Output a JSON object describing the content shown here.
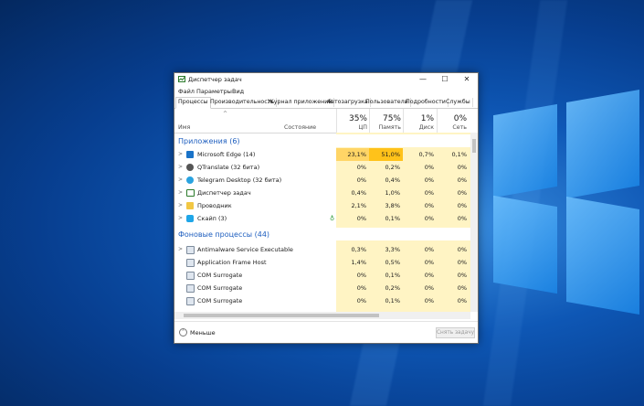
{
  "window": {
    "title": "Диспетчер задач",
    "minimize_glyph": "—",
    "maximize_glyph": "☐",
    "close_glyph": "✕"
  },
  "menu": [
    "Файл",
    "Параметры",
    "Вид"
  ],
  "tabs": [
    "Процессы",
    "Производительность",
    "Журнал приложений",
    "Автозагрузка",
    "Пользователи",
    "Подробности",
    "Службы"
  ],
  "active_tab": "Процессы",
  "columns": {
    "name": "Имя",
    "status": "Состояние",
    "cpu": {
      "percent": "35%",
      "label": "ЦП"
    },
    "memory": {
      "percent": "75%",
      "label": "Память"
    },
    "disk": {
      "percent": "1%",
      "label": "Диск"
    },
    "network": {
      "percent": "0%",
      "label": "Сеть"
    }
  },
  "groups": {
    "apps": "Приложения (6)",
    "background": "Фоновые процессы (44)"
  },
  "apps": [
    {
      "name": "Microsoft Edge (14)",
      "cpu": "23,1%",
      "mem": "51,0%",
      "disk": "0,7%",
      "net": "0,1%",
      "icon": "edge-icon"
    },
    {
      "name": "QTranslate (32 бита)",
      "cpu": "0%",
      "mem": "0,2%",
      "disk": "0%",
      "net": "0%",
      "icon": "qtranslate-icon"
    },
    {
      "name": "Telegram Desktop (32 бита)",
      "cpu": "0%",
      "mem": "0,4%",
      "disk": "0%",
      "net": "0%",
      "icon": "telegram-icon"
    },
    {
      "name": "Диспетчер задач",
      "cpu": "0,4%",
      "mem": "1,0%",
      "disk": "0%",
      "net": "0%",
      "icon": "task-manager-icon"
    },
    {
      "name": "Проводник",
      "cpu": "2,1%",
      "mem": "3,8%",
      "disk": "0%",
      "net": "0%",
      "icon": "explorer-icon"
    },
    {
      "name": "Скайп (3)",
      "cpu": "0%",
      "mem": "0,1%",
      "disk": "0%",
      "net": "0%",
      "icon": "skype-icon"
    }
  ],
  "background": [
    {
      "name": "Antimalware Service Executable",
      "cpu": "0,3%",
      "mem": "3,3%",
      "disk": "0%",
      "net": "0%"
    },
    {
      "name": "Application Frame Host",
      "cpu": "1,4%",
      "mem": "0,5%",
      "disk": "0%",
      "net": "0%"
    },
    {
      "name": "COM Surrogate",
      "cpu": "0%",
      "mem": "0,1%",
      "disk": "0%",
      "net": "0%"
    },
    {
      "name": "COM Surrogate",
      "cpu": "0%",
      "mem": "0,2%",
      "disk": "0%",
      "net": "0%"
    },
    {
      "name": "COM Surrogate",
      "cpu": "0%",
      "mem": "0,1%",
      "disk": "0%",
      "net": "0%"
    }
  ],
  "footer": {
    "fewer": "Меньше",
    "end_task": "Снять задачу"
  },
  "colors": {
    "group_header": "#1f5fbf",
    "cell_light": "#fff4c4",
    "cell_hot_cpu": "#ffd566",
    "cell_hot_mem": "#ffc21a"
  }
}
